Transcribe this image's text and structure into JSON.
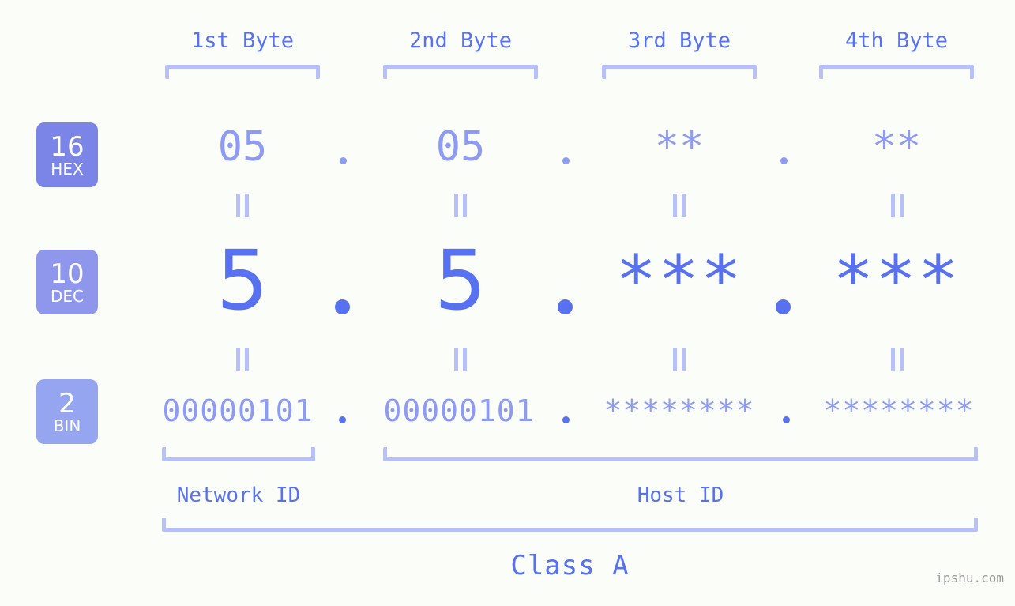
{
  "page": {
    "background_color": "#fbfdf8",
    "accent_color": "#5771f0",
    "accent_light_color": "#8e9bf5",
    "bracket_color": "#b7c0fb",
    "watermark": "ipshu.com"
  },
  "columns": [
    {
      "header": "1st Byte"
    },
    {
      "header": "2nd Byte"
    },
    {
      "header": "3rd Byte"
    },
    {
      "header": "4th Byte"
    }
  ],
  "bases": [
    {
      "number": "16",
      "name": "HEX",
      "color": "#7b85e8"
    },
    {
      "number": "10",
      "name": "DEC",
      "color": "#8f97ec"
    },
    {
      "number": "2",
      "name": "BIN",
      "color": "#96a5f0"
    }
  ],
  "rows": {
    "hex": {
      "values": [
        "05",
        "05",
        "**",
        "**"
      ],
      "separator": "."
    },
    "dec": {
      "values": [
        "5",
        "5",
        "***",
        "***"
      ],
      "separator": "."
    },
    "bin": {
      "values": [
        "00000101",
        "00000101",
        "********",
        "********"
      ],
      "separator": "."
    }
  },
  "equals_marks": {
    "glyph": "||",
    "count_per_row_gap": 4
  },
  "regions": [
    {
      "label": "Network ID"
    },
    {
      "label": "Host ID"
    }
  ],
  "class": {
    "label": "Class A"
  }
}
